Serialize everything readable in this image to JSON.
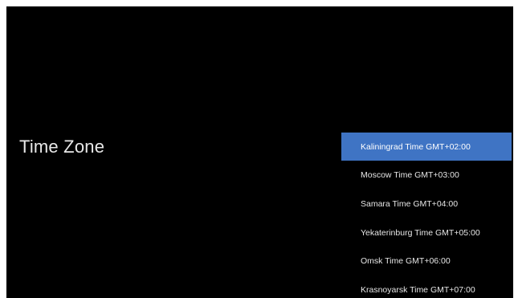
{
  "settings": {
    "title": "Time Zone",
    "selected_index": 0,
    "accent_color": "#3f74c4",
    "timezones": [
      "Kaliningrad Time GMT+02:00",
      "Moscow Time GMT+03:00",
      "Samara Time GMT+04:00",
      "Yekaterinburg Time GMT+05:00",
      "Omsk Time GMT+06:00",
      "Krasnoyarsk Time GMT+07:00"
    ]
  }
}
